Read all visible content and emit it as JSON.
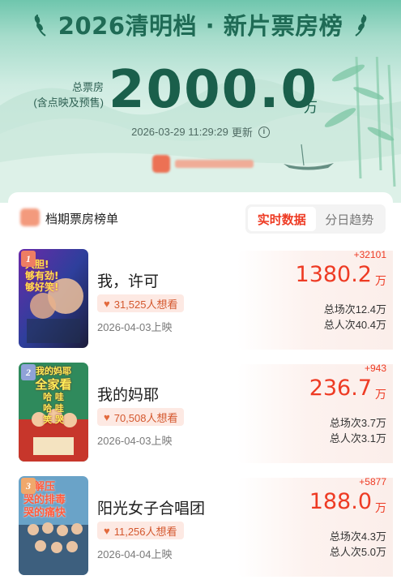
{
  "header": {
    "title": "2026清明档 · 新片票房榜",
    "total_label_line1": "总票房",
    "total_label_line2": "(含点映及预售)",
    "total_value": "2000.0",
    "total_unit": "万",
    "update_time": "2026-03-29 11:29:29",
    "update_suffix": "更新"
  },
  "list": {
    "title": "档期票房榜单",
    "tabs": [
      {
        "label": "实时数据",
        "active": true
      },
      {
        "label": "分日趋势",
        "active": false
      }
    ]
  },
  "movies": [
    {
      "rank": "1",
      "name": "我，许可",
      "want": "31,525人想看",
      "release": "2026-04-03上映",
      "delta": "+32101",
      "box": "1380.2",
      "unit": "万",
      "sessions": "总场次12.4万",
      "viewers": "总人次40.4万",
      "poster_text": [
        "大胆!",
        "够有劲!",
        "够好笑!"
      ]
    },
    {
      "rank": "2",
      "name": "我的妈耶",
      "want": "70,508人想看",
      "release": "2026-04-03上映",
      "delta": "+943",
      "box": "236.7",
      "unit": "万",
      "sessions": "总场次3.7万",
      "viewers": "总人次3.1万",
      "poster_text": [
        "我的妈耶",
        "全家看",
        "哈 哇",
        "哈 哇",
        "笑 哭"
      ]
    },
    {
      "rank": "3",
      "name": "阳光女子合唱团",
      "want": "11,256人想看",
      "release": "2026-04-04上映",
      "delta": "+5877",
      "box": "188.0",
      "unit": "万",
      "sessions": "总场次4.3万",
      "viewers": "总人次5.0万",
      "poster_text": [
        "的解压",
        "哭的排毒",
        "哭的痛快"
      ]
    }
  ],
  "colors": {
    "accent_red": "#ee3b24",
    "header_green": "#1f6b55",
    "want_bg": "#fde9e3"
  }
}
